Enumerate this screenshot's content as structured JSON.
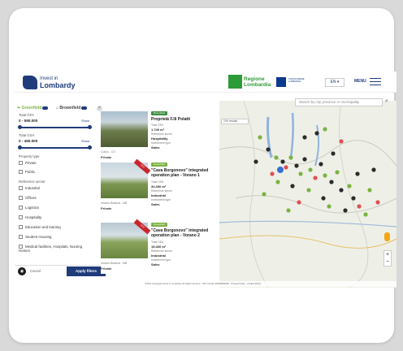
{
  "header": {
    "logo_small": "Invest in",
    "logo_big": "Lombardy",
    "regione_line1": "Regione",
    "regione_line2": "Lombardia",
    "partner_text": "UNIONCAMERE LOMBARDIA",
    "language": "EN ▾",
    "menu_label": "MENU"
  },
  "filters": {
    "greenfield": "Greenfield",
    "brownfield": "Brownfield",
    "total_gfa_label": "Total GFA",
    "total_gfa_value": "0 - 590.000",
    "show_label": "Show",
    "total_gsa_label": "Total GSA",
    "total_gsa_value": "0 - 460.000",
    "property_type_label": "Property type",
    "property_types": [
      "Private",
      "Public"
    ],
    "reference_sector_label": "Reference sector",
    "sectors": [
      "Industrial",
      "Offices",
      "Logistics",
      "Hospitality",
      "Education and training",
      "Student Housing",
      "Medical facilities, Hospitals, Nursing Homes"
    ],
    "cancel": "Cancel",
    "apply": "Apply filters"
  },
  "results": [
    {
      "badge": "Brownfield",
      "title": "Proprietà F.lli Polatti",
      "loc": "Colico - CO",
      "owner": "Private",
      "gfa_label": "Total GFA",
      "gfa": "1.740 m²",
      "sector_label": "Reference sector",
      "sector": "Hospitality",
      "inv_label": "Investment type",
      "inv": "Sales"
    },
    {
      "badge": "Greenfield",
      "ribbon": "NEW",
      "title": "\"Cava Borgonovo\" integrated operation plan - Vorano 1",
      "loc": "Vorano Brianza - MB",
      "owner": "Private",
      "gfa_label": "Total GSA",
      "gfa": "34.400 m²",
      "sector_label": "Reference sector",
      "sector": "Industrial",
      "inv_label": "Investment type",
      "inv": "Sales"
    },
    {
      "badge": "Greenfield",
      "ribbon": "NEW",
      "title": "\"Cava Borgonovo\" integrated operation plan - Vorano 2",
      "loc": "Vorano Brianza - MB",
      "owner": "Private",
      "gfa_label": "Total GSA",
      "gfa": "15.400 m²",
      "sector_label": "Reference sector",
      "sector": "Industrial",
      "inv_label": "Investment type",
      "inv": "Sales"
    }
  ],
  "map": {
    "search_placeholder": "Search by city, province or municipality",
    "results_count": "199 results",
    "footer": "©2024 Copyright Invest in Lombardy all rights reserved · VAT number 00000000000 · Privacy Policy · Cookie Policy"
  }
}
